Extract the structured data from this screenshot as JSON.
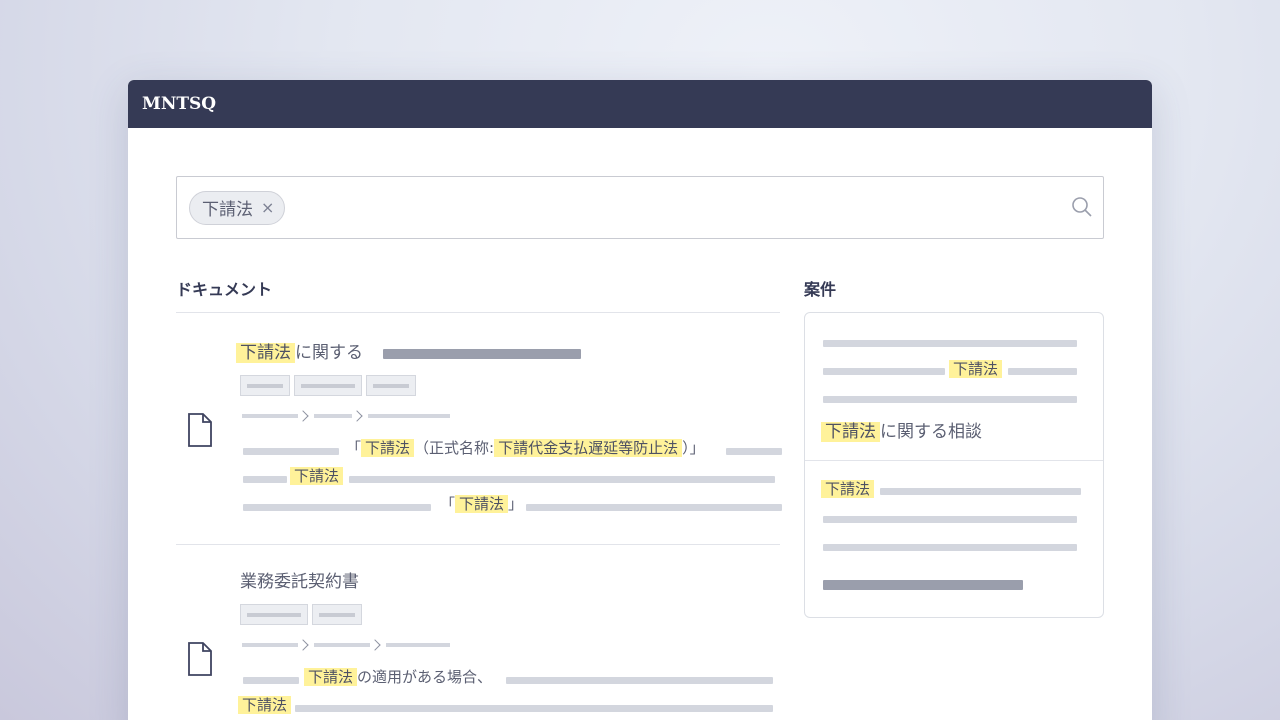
{
  "app": {
    "logo": "MNTSQ"
  },
  "search": {
    "chip_label": "下請法",
    "chip_close": "×"
  },
  "sections": {
    "documents": "ドキュメント",
    "cases": "案件"
  },
  "doc1": {
    "title_hl": "下請法",
    "title_rest": "に関する",
    "quote_open": "「",
    "hl1": "下請法",
    "mid": "（正式名称:",
    "hl2": "下請代金支払遅延等防止法",
    "quote_close": "）」",
    "hl3": "下請法",
    "hl4": "下請法",
    "q3_open": "「",
    "q3_close": "」"
  },
  "doc2": {
    "title": "業務委託契約書",
    "hl1": "下請法",
    "line1_rest": "の適用がある場合、",
    "hl2": "下請法"
  },
  "case": {
    "hl1": "下請法",
    "title_hl": "下請法",
    "title_rest": "に関する相談",
    "hl2": "下請法"
  }
}
